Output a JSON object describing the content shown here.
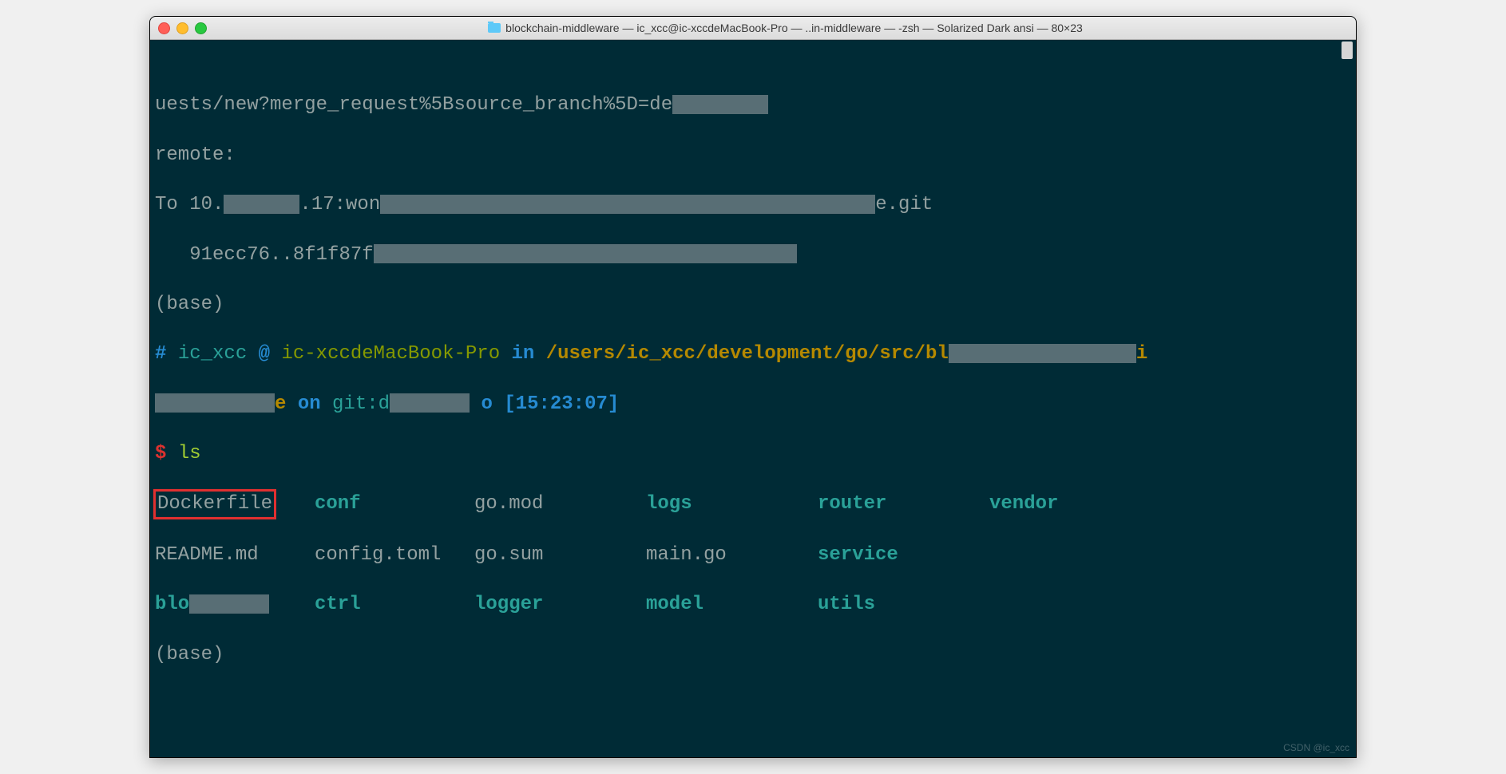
{
  "titlebar": {
    "title": "blockchain-middleware — ic_xcc@ic-xccdeMacBook-Pro — ..in-middleware — -zsh — Solarized Dark ansi — 80×23"
  },
  "terminal": {
    "line1_a": "uests/new?merge_request%5Bsource_branch%5D=de",
    "line2": "remote:",
    "line3_a": "To 10.",
    "line3_b": ".17:won",
    "line3_c": "e.git",
    "line4_a": "   91ecc76..8f1f87f",
    "line5": "(base)",
    "prompt_hash": "# ",
    "prompt_user": "ic_xcc",
    "prompt_at": " @ ",
    "prompt_host": "ic-xccdeMacBook-Pro",
    "prompt_in": " in ",
    "prompt_path": "/users/ic_xcc/development/go/src/bl",
    "prompt_path_tail": "i",
    "line7_a": "e ",
    "on": "on ",
    "git_prefix": "git:",
    "git_branch": "d",
    "git_o": " o ",
    "time": "[15:23:07]",
    "prompt_dollar": "$ ",
    "cmd_ls": "ls",
    "row1": {
      "c1": "Dockerfile",
      "c2": "conf",
      "c3": "go.mod",
      "c4": "logs",
      "c5": "router",
      "c6": "vendor"
    },
    "row2": {
      "c1": "README.md",
      "c2": "config.toml",
      "c3": "go.sum",
      "c4": "main.go",
      "c5": "service"
    },
    "row3": {
      "c1": "blo",
      "c2": "ctrl",
      "c3": "logger",
      "c4": "model",
      "c5": "utils"
    },
    "base2": "(base)"
  },
  "watermark": "CSDN @ic_xcc"
}
